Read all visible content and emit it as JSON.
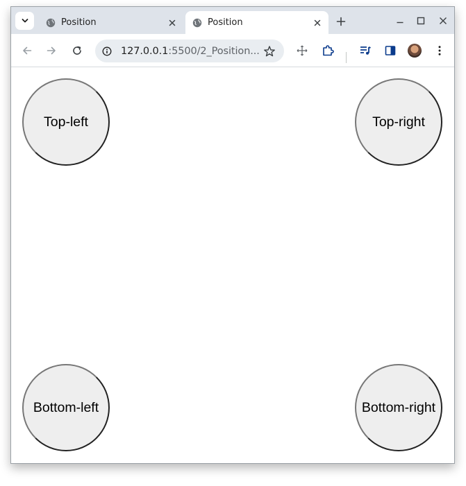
{
  "tabs": [
    {
      "title": "Position",
      "active": false
    },
    {
      "title": "Position",
      "active": true
    }
  ],
  "toolbar": {
    "url_host": "127.0.0.1",
    "url_rest": ":5500/2_Position..."
  },
  "page": {
    "corners": {
      "top_left": "Top-left",
      "top_right": "Top-right",
      "bottom_left": "Bottom-left",
      "bottom_right": "Bottom-right"
    }
  },
  "icons": [
    "tab-search-icon",
    "globe-icon",
    "close-icon",
    "new-tab-icon",
    "minimize-icon",
    "maximize-icon",
    "window-close-icon",
    "back-icon",
    "forward-icon",
    "reload-icon",
    "site-info-icon",
    "bookmark-star-icon",
    "move-icon",
    "extensions-icon",
    "media-icon",
    "side-panel-icon",
    "avatar",
    "menu-icon"
  ],
  "colors": {
    "tabstrip": "#dee3ea",
    "circle_fill": "#eeeeee",
    "omnibox": "#e9edf1"
  }
}
